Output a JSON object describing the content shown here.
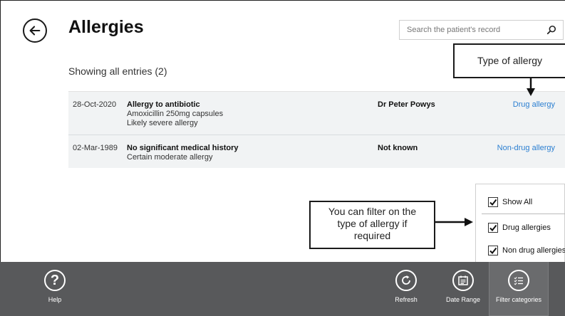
{
  "header": {
    "title": "Allergies",
    "back_icon": "arrow-left-icon"
  },
  "search": {
    "placeholder": "Search the patient's record",
    "icon": "search-icon"
  },
  "summary": {
    "showing_text": "Showing all entries (2)"
  },
  "entries": [
    {
      "date": "28-Oct-2020",
      "description": "Allergy to antibiotic",
      "detail_lines": [
        "Amoxicillin 250mg capsules",
        "Likely severe allergy"
      ],
      "clinician": "Dr Peter Powys",
      "type": "Drug allergy"
    },
    {
      "date": "02-Mar-1989",
      "description": "No significant medical history",
      "detail_lines": [
        "Certain moderate allergy"
      ],
      "clinician": "Not known",
      "type": "Non-drug allergy"
    }
  ],
  "callouts": {
    "type_of_allergy": "Type of allergy",
    "filter_hint_lines": [
      "You can filter on the",
      "type of allergy if",
      "required"
    ]
  },
  "filter_panel": {
    "show_all": {
      "label": "Show All",
      "checked": true
    },
    "drug": {
      "label": "Drug allergies",
      "checked": true
    },
    "non_drug": {
      "label": "Non drug allergies",
      "checked": true
    }
  },
  "bottom_bar": {
    "help": {
      "label": "Help",
      "icon": "help-icon"
    },
    "refresh": {
      "label": "Refresh",
      "icon": "refresh-icon"
    },
    "date_range": {
      "label": "Date Range",
      "icon": "calendar-icon"
    },
    "filter_categories": {
      "label": "Filter categories",
      "icon": "filter-list-icon"
    }
  },
  "colors": {
    "link": "#2b7fd1",
    "row_background": "#f1f3f4",
    "bottom_bar": "#58595b"
  }
}
